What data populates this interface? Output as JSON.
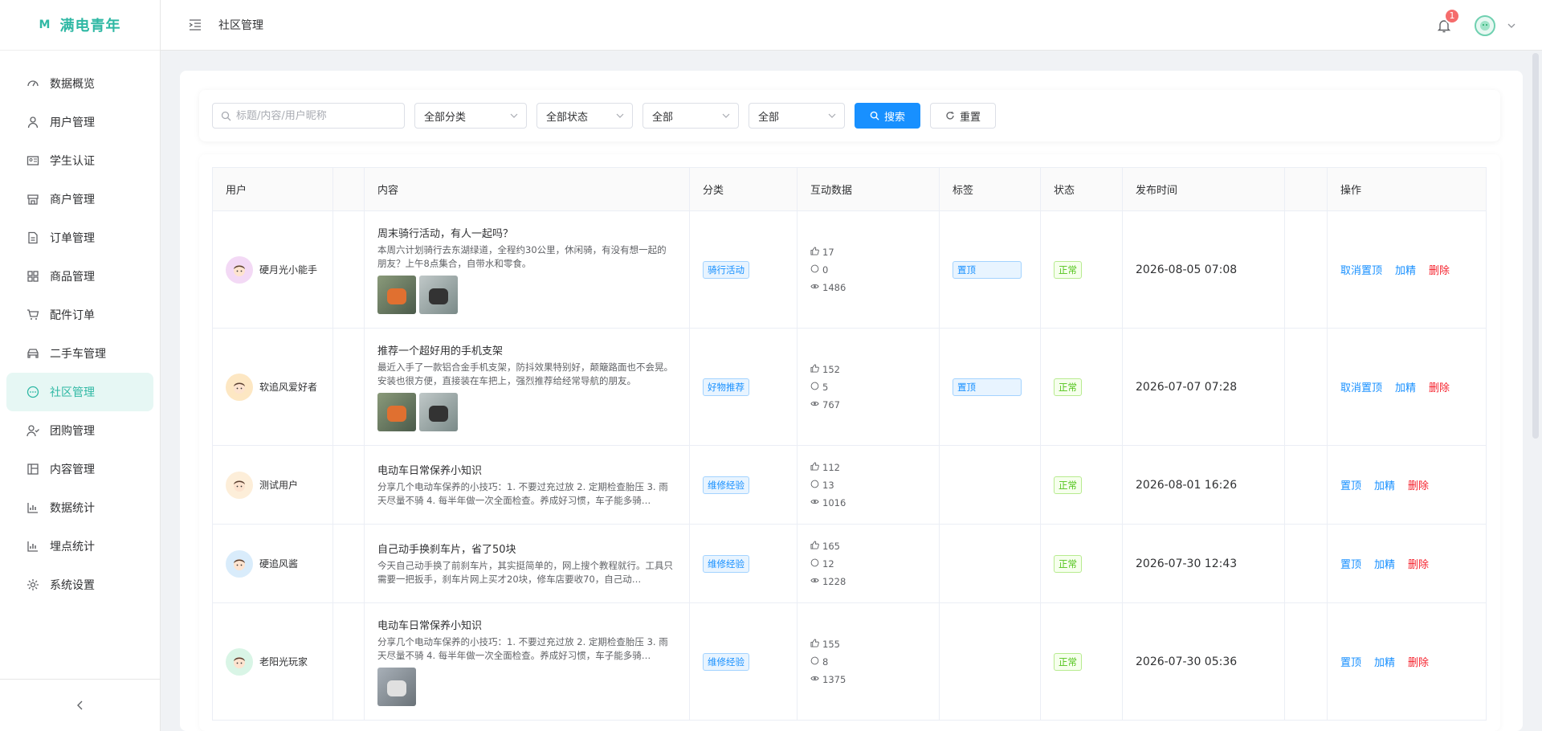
{
  "app": {
    "logo_mark": "M",
    "name": "满电青年"
  },
  "sidebar": {
    "items": [
      {
        "label": "数据概览",
        "icon": "dashboard-icon"
      },
      {
        "label": "用户管理",
        "icon": "user-icon"
      },
      {
        "label": "学生认证",
        "icon": "id-card-icon"
      },
      {
        "label": "商户管理",
        "icon": "shop-icon"
      },
      {
        "label": "订单管理",
        "icon": "document-icon"
      },
      {
        "label": "商品管理",
        "icon": "grid-icon"
      },
      {
        "label": "配件订单",
        "icon": "cart-icon"
      },
      {
        "label": "二手车管理",
        "icon": "car-icon"
      },
      {
        "label": "社区管理",
        "icon": "chat-icon",
        "active": true
      },
      {
        "label": "团购管理",
        "icon": "group-icon"
      },
      {
        "label": "内容管理",
        "icon": "layout-icon"
      },
      {
        "label": "数据统计",
        "icon": "bar-chart-icon"
      },
      {
        "label": "埋点统计",
        "icon": "bar-chart-icon"
      },
      {
        "label": "系统设置",
        "icon": "gear-icon"
      }
    ]
  },
  "header": {
    "title": "社区管理",
    "notification_count": "1"
  },
  "filters": {
    "search_placeholder": "标题/内容/用户昵称",
    "category": "全部分类",
    "status": "全部状态",
    "filter3": "全部",
    "filter4": "全部",
    "search_label": "搜索",
    "reset_label": "重置"
  },
  "table": {
    "headers": [
      "用户",
      "",
      "内容",
      "分类",
      "互动数据",
      "标签",
      "状态",
      "发布时间",
      "",
      "操作"
    ],
    "rows": [
      {
        "user": "硬月光小能手",
        "avatar_color": "#f3d9f5",
        "title": "周末骑行活动，有人一起吗？",
        "desc": "本周六计划骑行去东湖绿道，全程约30公里，休闲骑，有没有想一起的朋友？上午8点集合，自带水和零食。",
        "images": 2,
        "category": "骑行活动",
        "likes": "17",
        "comments": "0",
        "views": "1486",
        "tag": "置顶",
        "status": "正常",
        "time": "2026-08-05 07:08",
        "ops": [
          "取消置顶",
          "加精",
          "删除"
        ]
      },
      {
        "user": "软追风爱好者",
        "avatar_color": "#fde7c3",
        "title": "推荐一个超好用的手机支架",
        "desc": "最近入手了一款铝合金手机支架，防抖效果特别好，颠簸路面也不会晃。安装也很方便，直接装在车把上，强烈推荐给经常导航的朋友。",
        "images": 2,
        "category": "好物推荐",
        "likes": "152",
        "comments": "5",
        "views": "767",
        "tag": "置顶",
        "status": "正常",
        "time": "2026-07-07 07:28",
        "ops": [
          "取消置顶",
          "加精",
          "删除"
        ]
      },
      {
        "user": "测试用户",
        "avatar_color": "#fdeed9",
        "title": "电动车日常保养小知识",
        "desc": "分享几个电动车保养的小技巧：1. 不要过充过放 2. 定期检查胎压 3. 雨天尽量不骑 4. 每半年做一次全面检查。养成好习惯，车子能多骑…",
        "images": 0,
        "category": "维修经验",
        "likes": "112",
        "comments": "13",
        "views": "1016",
        "tag": "",
        "status": "正常",
        "time": "2026-08-01 16:26",
        "ops": [
          "置顶",
          "加精",
          "删除"
        ]
      },
      {
        "user": "硬追风酱",
        "avatar_color": "#d9ecfb",
        "title": "自己动手换刹车片，省了50块",
        "desc": "今天自己动手换了前刹车片，其实挺简单的，网上搜个教程就行。工具只需要一把扳手，刹车片网上买才20块，修车店要收70，自己动…",
        "images": 0,
        "category": "维修经验",
        "likes": "165",
        "comments": "12",
        "views": "1228",
        "tag": "",
        "status": "正常",
        "time": "2026-07-30 12:43",
        "ops": [
          "置顶",
          "加精",
          "删除"
        ]
      },
      {
        "user": "老阳光玩家",
        "avatar_color": "#d9f5e6",
        "title": "电动车日常保养小知识",
        "desc": "分享几个电动车保养的小技巧：1. 不要过充过放 2. 定期检查胎压 3. 雨天尽量不骑 4. 每半年做一次全面检查。养成好习惯，车子能多骑…",
        "images": 1,
        "category": "维修经验",
        "likes": "155",
        "comments": "8",
        "views": "1375",
        "tag": "",
        "status": "正常",
        "time": "2026-07-30 05:36",
        "ops": [
          "置顶",
          "加精",
          "删除"
        ]
      }
    ]
  },
  "colors": {
    "accent": "#2fb8a4",
    "primary": "#1890ff",
    "danger": "#f5222d",
    "success": "#52c41a"
  }
}
